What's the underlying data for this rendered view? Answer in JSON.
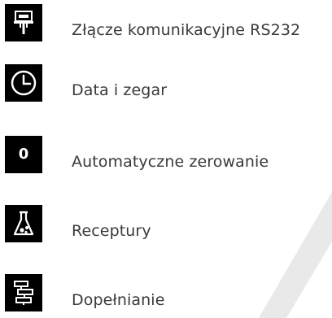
{
  "menu": {
    "items": [
      {
        "label": "Złącze komunikacyjne RS232",
        "icon": "rs232-connector-icon"
      },
      {
        "label": "Data i zegar",
        "icon": "clock-icon"
      },
      {
        "label": "Automatyczne zerowanie",
        "icon": "zero-icon",
        "glyph": "0"
      },
      {
        "label": "Receptury",
        "icon": "flask-icon"
      },
      {
        "label": "Dopełnianie",
        "icon": "filling-icon"
      }
    ]
  },
  "colors": {
    "icon_background": "#000000",
    "icon_foreground": "#ffffff",
    "label_text": "#3a3a3a",
    "page_background": "#ffffff",
    "watermark": "#e6e6e6"
  }
}
